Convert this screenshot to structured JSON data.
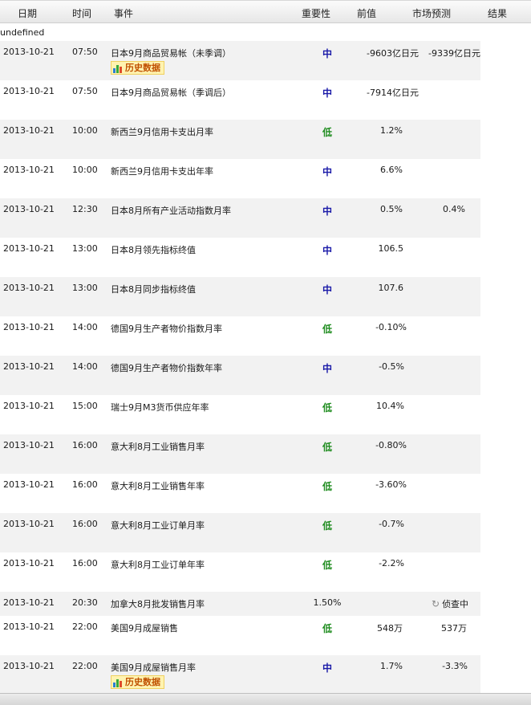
{
  "header": {
    "date": "日期",
    "time": "时间",
    "event": "事件",
    "importance": "重要性",
    "previous": "前值",
    "forecast": "市场预测",
    "result": "结果"
  },
  "notice": "undefined",
  "history_label": "历史数据",
  "investigating_label": "侦查中",
  "rows": [
    {
      "date": "2013-10-21",
      "time": "07:50",
      "event": "日本9月商品贸易帐（未季调）",
      "importance": "中",
      "previous": "-9603亿日元",
      "forecast": "-9339亿日元"
    },
    {
      "date": "2013-10-21",
      "time": "07:50",
      "event": "日本9月商品贸易帐（季调后）",
      "importance": "中",
      "previous": "-7914亿日元",
      "forecast": ""
    },
    {
      "date": "2013-10-21",
      "time": "10:00",
      "event": "新西兰9月信用卡支出月率",
      "importance": "低",
      "previous": "1.2%",
      "forecast": ""
    },
    {
      "date": "2013-10-21",
      "time": "10:00",
      "event": "新西兰9月信用卡支出年率",
      "importance": "中",
      "previous": "6.6%",
      "forecast": ""
    },
    {
      "date": "2013-10-21",
      "time": "12:30",
      "event": "日本8月所有产业活动指数月率",
      "importance": "中",
      "previous": "0.5%",
      "forecast": "0.4%"
    },
    {
      "date": "2013-10-21",
      "time": "13:00",
      "event": "日本8月领先指标终值",
      "importance": "中",
      "previous": "106.5",
      "forecast": ""
    },
    {
      "date": "2013-10-21",
      "time": "13:00",
      "event": "日本8月同步指标终值",
      "importance": "中",
      "previous": "107.6",
      "forecast": ""
    },
    {
      "date": "2013-10-21",
      "time": "14:00",
      "event": "德国9月生产者物价指数月率",
      "importance": "低",
      "previous": "-0.10%",
      "forecast": ""
    },
    {
      "date": "2013-10-21",
      "time": "14:00",
      "event": "德国9月生产者物价指数年率",
      "importance": "中",
      "previous": "-0.5%",
      "forecast": ""
    },
    {
      "date": "2013-10-21",
      "time": "15:00",
      "event": "瑞士9月M3货币供应年率",
      "importance": "低",
      "previous": "10.4%",
      "forecast": ""
    },
    {
      "date": "2013-10-21",
      "time": "16:00",
      "event": "意大利8月工业销售月率",
      "importance": "低",
      "previous": "-0.80%",
      "forecast": ""
    },
    {
      "date": "2013-10-21",
      "time": "16:00",
      "event": "意大利8月工业销售年率",
      "importance": "低",
      "previous": "-3.60%",
      "forecast": ""
    },
    {
      "date": "2013-10-21",
      "time": "16:00",
      "event": "意大利8月工业订单月率",
      "importance": "低",
      "previous": "-0.7%",
      "forecast": ""
    },
    {
      "date": "2013-10-21",
      "time": "16:00",
      "event": "意大利8月工业订单年率",
      "importance": "低",
      "previous": "-2.2%",
      "forecast": ""
    },
    {
      "date": "2013-10-21",
      "time": "20:30",
      "event": "加拿大8月批发销售月率",
      "importance": "1.50%",
      "previous": "",
      "forecast": ""
    },
    {
      "date": "2013-10-21",
      "time": "22:00",
      "event": "美国9月成屋销售",
      "importance": "低",
      "previous": "548万",
      "forecast": "537万"
    },
    {
      "date": "2013-10-21",
      "time": "22:00",
      "event": "美国9月成屋销售月率",
      "importance": "中",
      "previous": "1.7%",
      "forecast": "-3.3%"
    }
  ]
}
